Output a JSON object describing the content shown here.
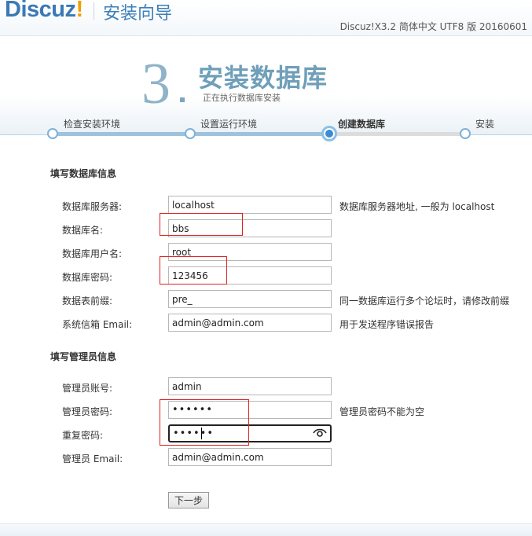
{
  "header": {
    "logo_main": "Discuz",
    "logo_bang": "!",
    "wizard_title": "安装向导",
    "version": "Discuz!X3.2 简体中文 UTF8 版 20160601"
  },
  "step": {
    "number": "3",
    "title": "安装数据库",
    "subtitle": "正在执行数据库安装"
  },
  "progress": {
    "steps": [
      {
        "label": "检查安装环境"
      },
      {
        "label": "设置运行环境"
      },
      {
        "label": "创建数据库"
      },
      {
        "label": "安装"
      }
    ],
    "current_index": 2
  },
  "db_section": {
    "title": "填写数据库信息",
    "fields": [
      {
        "label": "数据库服务器:",
        "value": "localhost",
        "hint": "数据库服务器地址, 一般为 localhost"
      },
      {
        "label": "数据库名:",
        "value": "bbs",
        "hint": ""
      },
      {
        "label": "数据库用户名:",
        "value": "root",
        "hint": ""
      },
      {
        "label": "数据库密码:",
        "value": "123456",
        "hint": ""
      },
      {
        "label": "数据表前缀:",
        "value": "pre_",
        "hint": "同一数据库运行多个论坛时，请修改前缀"
      },
      {
        "label": "系统信箱 Email:",
        "value": "admin@admin.com",
        "hint": "用于发送程序错误报告"
      }
    ]
  },
  "admin_section": {
    "title": "填写管理员信息",
    "fields": [
      {
        "label": "管理员账号:",
        "value": "admin",
        "hint": ""
      },
      {
        "label": "管理员密码:",
        "value": "••••••",
        "hint": "管理员密码不能为空"
      },
      {
        "label": "重复密码:",
        "value": "••••••",
        "hint": ""
      },
      {
        "label": "管理员 Email:",
        "value": "admin@admin.com",
        "hint": ""
      }
    ]
  },
  "buttons": {
    "next": "下一步"
  },
  "colors": {
    "brand_blue": "#3a79b6",
    "logo_accent": "#f0a000",
    "step_title": "#6f9fb9",
    "annotation_red": "#e02020"
  },
  "icons": {
    "password_reveal": "eye-icon"
  }
}
